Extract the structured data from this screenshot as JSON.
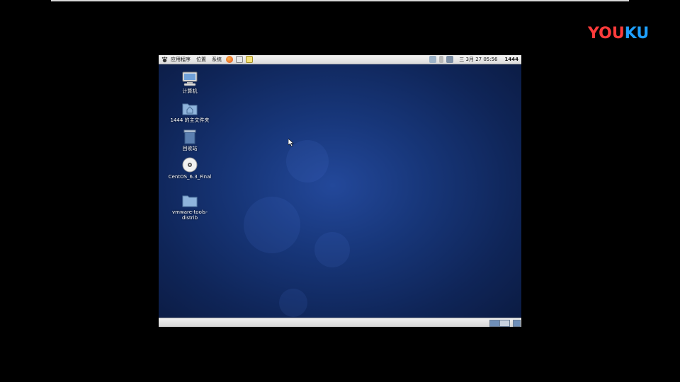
{
  "watermark": {
    "part1": "YOU",
    "part2": "KU"
  },
  "panel": {
    "menus": [
      "应用程序",
      "位置",
      "系统"
    ],
    "clock": "三 3月 27 05:56",
    "user": "1444"
  },
  "desktop": {
    "icons": [
      {
        "label": "计算机",
        "icon": "computer-icon"
      },
      {
        "label": "1444 的主文件夹",
        "icon": "home-folder-icon"
      },
      {
        "label": "回收站",
        "icon": "trash-icon"
      },
      {
        "label": "CentOS_6.3_Final",
        "icon": "dvd-icon"
      },
      {
        "label": "vmware-tools-\ndistrib",
        "icon": "folder-icon"
      }
    ]
  },
  "colors": {
    "desktop_bg": "#173679",
    "panel_bg": "#e6e6e6",
    "youku_red": "#ff3b3b",
    "youku_blue": "#1fa0ff"
  }
}
